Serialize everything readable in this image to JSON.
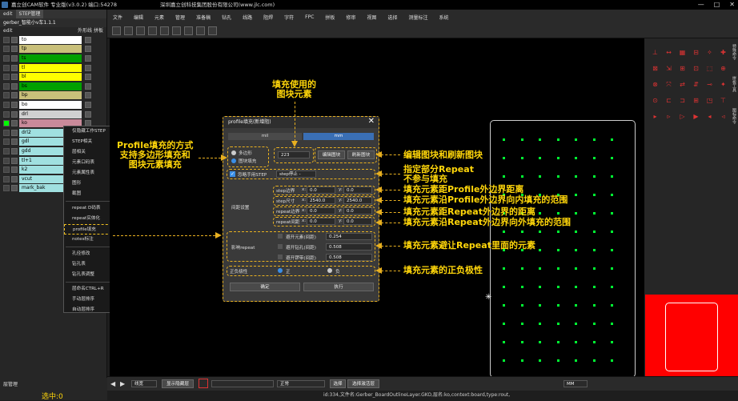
{
  "title": {
    "app": "嘉立创CAM软件 专业版(v3.0.2) 端口:54278",
    "company": "深圳嘉立创科技集团股份有限公司(www.jlc.com)",
    "win_min": "—",
    "win_max": "□",
    "win_close": "✕"
  },
  "left": {
    "tabs": [
      "edit",
      "STEP管理"
    ],
    "job": "gerber_智能小v车1.1.1",
    "header": {
      "edit": "edit",
      "outer": "外形线",
      "step": "拼板"
    },
    "layers": [
      {
        "name": "to",
        "color": "#ffffff"
      },
      {
        "name": "tp",
        "color": "#c9c07a"
      },
      {
        "name": "ts",
        "color": "#00a000"
      },
      {
        "name": "tl",
        "color": "#ffff00"
      },
      {
        "name": "bl",
        "color": "#ffff00"
      },
      {
        "name": "bs",
        "color": "#00a000"
      },
      {
        "name": "bp",
        "color": "#c9c07a"
      },
      {
        "name": "bo",
        "color": "#ffffff"
      },
      {
        "name": "drl",
        "color": "#d0d0d0"
      },
      {
        "name": "ko",
        "color": "#c98a9a"
      },
      {
        "name": "drl2",
        "color": "#a0e0e0"
      },
      {
        "name": "gdl",
        "color": "#a0e0e0"
      },
      {
        "name": "gdd",
        "color": "#a0e0e0"
      },
      {
        "name": "tl+1",
        "color": "#a0e0e0"
      },
      {
        "name": "k2",
        "color": "#a0e0e0"
      },
      {
        "name": "vcut",
        "color": "#a0e0e0"
      },
      {
        "name": "mark_bak",
        "color": "#a0e0e0"
      }
    ],
    "layer_manage": "层管理",
    "selected": "选中:0"
  },
  "context_menu": [
    "仅隐藏工作STEP",
    "STEP相关",
    "层相关",
    "元素口码表",
    "元素属性表",
    "图形",
    "截图",
    "repeat D码表",
    "repeat实体化",
    "profile填充",
    "notes标注",
    "孔径修改",
    "钻孔表",
    "钻孔表调整",
    "层命名CTRL+R",
    "手动层排序",
    "自动层排序"
  ],
  "menubar": [
    "文件",
    "编辑",
    "元素",
    "管理",
    "准备稿",
    "钻孔",
    "线路",
    "阻焊",
    "字符",
    "FPC",
    "拼板",
    "修审",
    "视图",
    "选择",
    "测量标注",
    "系统"
  ],
  "dialog": {
    "title": "profile填充(新增阻)",
    "tab_mil": "mil",
    "tab_mm": "mm",
    "radio_profile": "多边形",
    "radio_block": "图块填充",
    "block_value": "223",
    "edit_block": "编辑图块",
    "refresh_block": "刷新图块",
    "nostep_label": "忽略手用STEP",
    "step_select": "step停止 -",
    "spacing_label": "间距设置",
    "step_border": "step边界",
    "step_size": "step尺寸",
    "repeat_border": "repeat边界",
    "repeat_space": "repeat间距",
    "x1": "0.0",
    "y1": "0.0",
    "x2": "2540.0",
    "y2": "2540.0",
    "x3": "0.0",
    "y3": "0.0",
    "x4": "0.0",
    "y4": "0.0",
    "avoid_label": "影响repeat",
    "avoid1": "避开元素(间距)",
    "avoid1_val": "0.254",
    "avoid2": "避开钻孔(间距)",
    "avoid2_val": "0.508",
    "avoid3": "避开锣带(间距)",
    "avoid3_val": "0.508",
    "polarity_label": "正负极性",
    "pos": "正",
    "neg": "负",
    "ok": "确定",
    "apply": "执行"
  },
  "annotations": {
    "fill_block": "填充使用的\n图块元素",
    "profile_mode": "Profile填充的方式\n支持多边形填充和\n图块元素填充",
    "edit_refresh": "编辑图块和刷新图块",
    "repeat_fill": "指定部分Repeat\n不参与填充",
    "dist_profile": "填充元素距Profile外边界距离",
    "range_in": "填充元素沿Profile外边界向内填充的范围",
    "dist_repeat": "填充元素距Repeat外边界的距离",
    "range_out": "填充元素沿Repeat外边界向外填充的范围",
    "avoid": "填充元素避让Repeat里面的元素",
    "polarity": "填充元素的正负极性"
  },
  "right_tabs": [
    "特殊命令",
    "拼板工具",
    "图标命令"
  ],
  "bottom": {
    "layer": "线宽",
    "show_all": "显示隐藏层",
    "mode": "正常",
    "units": "MM",
    "select": "选择",
    "select_all": "选择激活层"
  },
  "status": "id:334,文件名:Gerber_BoardOutlineLayer.GKO,层名:ko,context:board,type:rout,"
}
